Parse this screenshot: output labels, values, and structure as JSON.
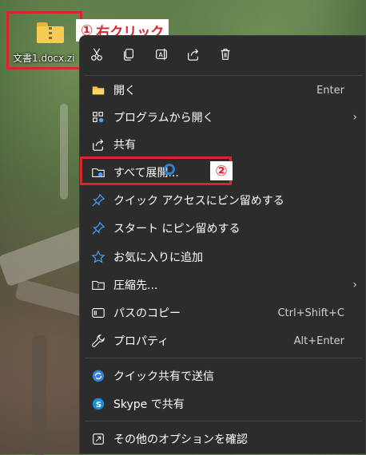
{
  "desktop": {
    "file_name": "文書1.docx.zi",
    "step1_number": "①",
    "step1_text": "右クリック",
    "step2_number": "②"
  },
  "toolbar": {
    "icons": [
      "cut-icon",
      "copy-icon",
      "rename-icon",
      "share-icon",
      "delete-icon"
    ]
  },
  "menu": {
    "items": [
      {
        "label": "開く",
        "shortcut": "Enter",
        "icon": "folder-open-icon"
      },
      {
        "label": "プログラムから開く",
        "submenu": "›",
        "icon": "open-with-icon"
      },
      {
        "label": "共有",
        "icon": "share-icon"
      },
      {
        "label": "すべて展開...",
        "icon": "extract-all-icon"
      },
      {
        "label": "クイック アクセスにピン留めする",
        "icon": "pin-icon"
      },
      {
        "label": "スタート にピン留めする",
        "icon": "pin-icon"
      },
      {
        "label": "お気に入りに追加",
        "icon": "star-icon"
      },
      {
        "label": "圧縮先...",
        "submenu": "›",
        "icon": "compress-icon"
      },
      {
        "label": "パスのコピー",
        "shortcut": "Ctrl+Shift+C",
        "icon": "copy-path-icon"
      },
      {
        "label": "プロパティ",
        "shortcut": "Alt+Enter",
        "icon": "wrench-icon"
      },
      {
        "label": "クイック共有で送信",
        "icon": "quick-share-icon"
      },
      {
        "label": "Skype で共有",
        "icon": "skype-icon"
      },
      {
        "label": "その他のオプションを確認",
        "icon": "more-options-icon"
      }
    ]
  },
  "colors": {
    "menu_bg": "#2c2c2c",
    "highlight": "#d8262d",
    "accent_blue": "#4aa3ff"
  }
}
